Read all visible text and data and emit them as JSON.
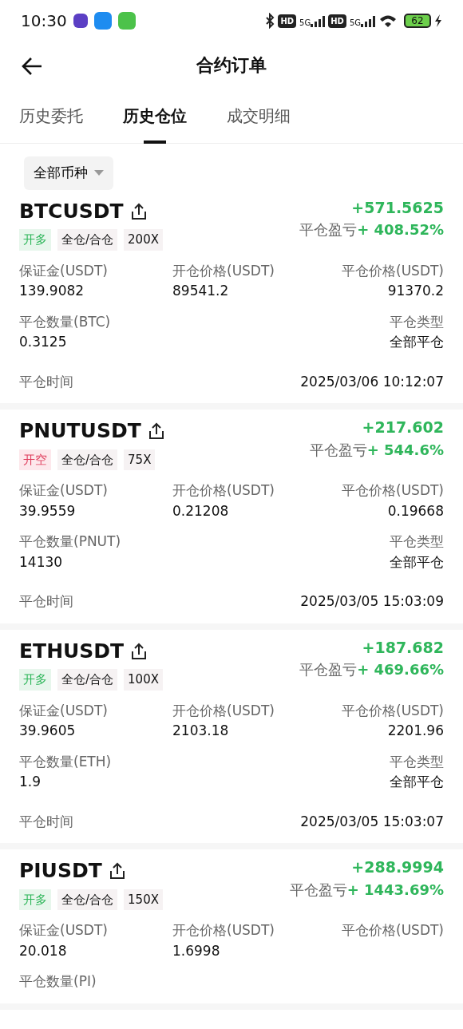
{
  "status_bar": {
    "time": "10:30",
    "hd_labels": [
      "HD",
      "HD"
    ],
    "network_labels": [
      "5G",
      "5G"
    ],
    "battery": "62"
  },
  "header": {
    "title": "合约订单"
  },
  "tabs": [
    {
      "label": "历史委托",
      "selected": false
    },
    {
      "label": "历史仓位",
      "selected": true
    },
    {
      "label": "成交明细",
      "selected": false
    }
  ],
  "filter": {
    "label": "全部币种"
  },
  "orders": [
    {
      "symbol": "BTCUSDT",
      "side": {
        "text": "开多",
        "kind": "long"
      },
      "tags": [
        "全仓/合仓",
        "200X"
      ],
      "pnl": "+571.5625",
      "pnl_label": "平仓盈亏",
      "pnl_rate": "+ 408.52%",
      "rows": [
        [
          {
            "label": "保证金(USDT)",
            "value": "139.9082"
          },
          {
            "label": "开仓价格(USDT)",
            "value": "89541.2"
          },
          {
            "label": "平仓价格(USDT)",
            "value": "91370.2"
          }
        ],
        [
          {
            "label": "平仓数量(BTC)",
            "value": "0.3125"
          },
          "",
          {
            "label": "平仓类型",
            "value": "全部平仓"
          }
        ]
      ],
      "time_label": "平仓时间",
      "time": "2025/03/06 10:12:07"
    },
    {
      "symbol": "PNUTUSDT",
      "side": {
        "text": "开空",
        "kind": "short"
      },
      "tags": [
        "全仓/合仓",
        "75X"
      ],
      "pnl": "+217.602",
      "pnl_label": "平仓盈亏",
      "pnl_rate": "+ 544.6%",
      "rows": [
        [
          {
            "label": "保证金(USDT)",
            "value": "39.9559"
          },
          {
            "label": "开仓价格(USDT)",
            "value": "0.21208"
          },
          {
            "label": "平仓价格(USDT)",
            "value": "0.19668"
          }
        ],
        [
          {
            "label": "平仓数量(PNUT)",
            "value": "14130"
          },
          "",
          {
            "label": "平仓类型",
            "value": "全部平仓"
          }
        ]
      ],
      "time_label": "平仓时间",
      "time": "2025/03/05 15:03:09"
    },
    {
      "symbol": "ETHUSDT",
      "side": {
        "text": "开多",
        "kind": "long"
      },
      "tags": [
        "全仓/合仓",
        "100X"
      ],
      "pnl": "+187.682",
      "pnl_label": "平仓盈亏",
      "pnl_rate": "+ 469.66%",
      "rows": [
        [
          {
            "label": "保证金(USDT)",
            "value": "39.9605"
          },
          {
            "label": "开仓价格(USDT)",
            "value": "2103.18"
          },
          {
            "label": "平仓价格(USDT)",
            "value": "2201.96"
          }
        ],
        [
          {
            "label": "平仓数量(ETH)",
            "value": "1.9"
          },
          "",
          {
            "label": "平仓类型",
            "value": "全部平仓"
          }
        ]
      ],
      "time_label": "平仓时间",
      "time": "2025/03/05 15:03:07"
    },
    {
      "symbol": "PIUSDT",
      "side": {
        "text": "开多",
        "kind": "long"
      },
      "tags": [
        "全仓/合仓",
        "150X"
      ],
      "pnl": "+288.9994",
      "pnl_label": "平仓盈亏",
      "pnl_rate": "+ 1443.69%",
      "rows": [
        [
          {
            "label": "保证金(USDT)",
            "value": "20.018"
          },
          {
            "label": "开仓价格(USDT)",
            "value": "1.6998"
          },
          {
            "label": "平仓价格(USDT)"
          }
        ],
        [
          {
            "label": "平仓数量(PI)"
          }
        ]
      ]
    }
  ]
}
